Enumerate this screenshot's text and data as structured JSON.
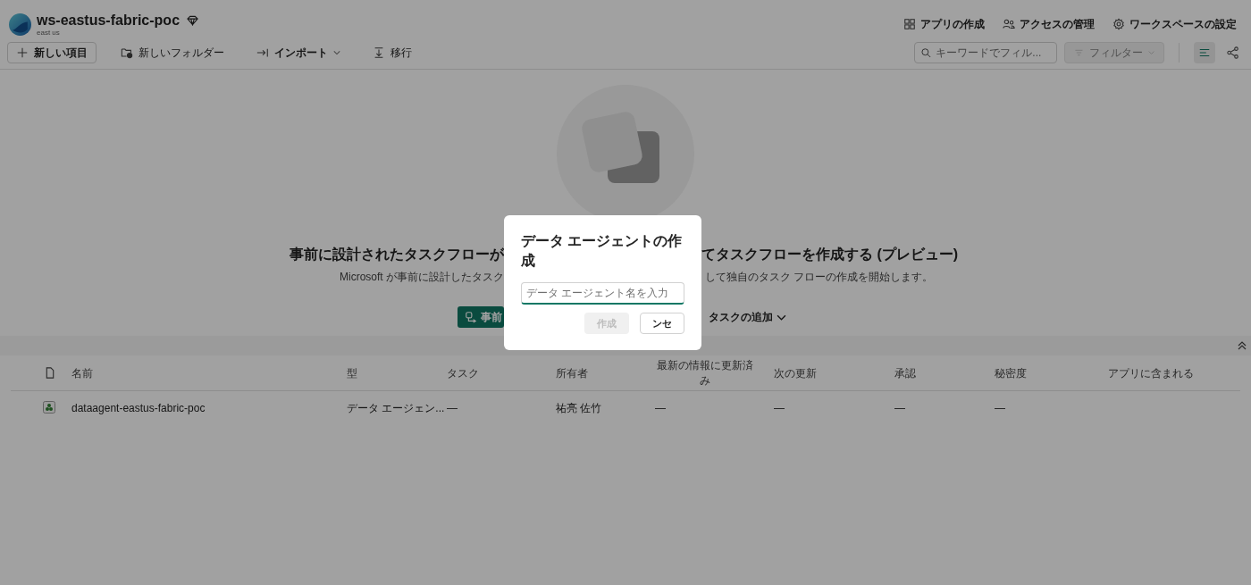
{
  "workspace": {
    "name": "ws-eastus-fabric-poc",
    "region": "east us"
  },
  "header_actions": [
    {
      "label": "アプリの作成",
      "kind": "app"
    },
    {
      "label": "アクセスの管理",
      "kind": "access"
    },
    {
      "label": "ワークスペースの設定",
      "kind": "settings"
    }
  ],
  "toolbar": {
    "items": [
      {
        "label": "新しい項目",
        "kind": "new"
      },
      {
        "label": "新しいフォルダー",
        "kind": "folder"
      },
      {
        "label": "インポート",
        "kind": "import"
      },
      {
        "label": "移行",
        "kind": "migrate"
      }
    ],
    "search": {
      "placeholder": "キーワードでフィル..."
    },
    "filter": {
      "label": "フィルター",
      "disabled": true
    },
    "view_buttons": [
      {
        "kind": "list",
        "selected": true
      },
      {
        "kind": "lineage",
        "selected": false
      }
    ]
  },
  "empty_state": {
    "heading_left": "事前に設計されたタスクフローが",
    "heading_right": "てタスクフローを作成する (プレビュー)",
    "subtitle_left": "Microsoft が事前に設計したタスク",
    "subtitle_right": "して独自のタスク フローの作成を開始します。",
    "primary_button": "事前",
    "secondary_button": "タスクの追加"
  },
  "table": {
    "columns": [
      "名前",
      "型",
      "タスク",
      "所有者",
      "最新の情報に更新済み",
      "次の更新",
      "承認",
      "秘密度",
      "アプリに含まれる"
    ],
    "rows": [
      {
        "cells": [
          "dataagent-eastus-fabric-poc",
          "データ エージェン...",
          "—",
          "祐亮 佐竹",
          "—",
          "—",
          "—",
          "—"
        ]
      }
    ]
  },
  "dialog": {
    "title": "データ エージェントの作成",
    "placeholder": "データ エージェント名を入力",
    "create": {
      "label": "作成",
      "disabled": true
    },
    "cancel": "ンセ"
  }
}
